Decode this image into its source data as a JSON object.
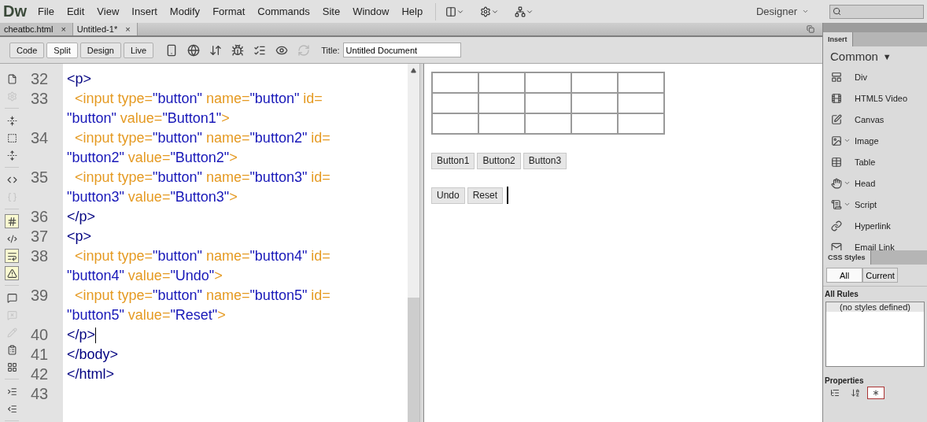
{
  "app": {
    "logo": "Dw",
    "menus": [
      "File",
      "Edit",
      "View",
      "Insert",
      "Modify",
      "Format",
      "Commands",
      "Site",
      "Window",
      "Help"
    ],
    "workspace": "Designer"
  },
  "document_tabs": [
    {
      "label": "cheatbc.html",
      "close": "×",
      "selected": false
    },
    {
      "label": "Untitled-1*",
      "close": "×",
      "selected": true
    }
  ],
  "view_buttons": [
    {
      "label": "Code",
      "selected": false
    },
    {
      "label": "Split",
      "selected": true
    },
    {
      "label": "Design",
      "selected": false
    },
    {
      "label": "Live",
      "selected": false
    }
  ],
  "toolbar_tools": [
    {
      "kind": "devices",
      "disabled": false
    },
    {
      "kind": "globe",
      "disabled": false
    },
    {
      "kind": "transfer",
      "disabled": false
    },
    {
      "kind": "debug",
      "disabled": false
    },
    {
      "kind": "check",
      "disabled": false
    },
    {
      "kind": "preview",
      "disabled": false
    },
    {
      "kind": "refresh",
      "disabled": true
    }
  ],
  "title_field": {
    "label": "Title:",
    "value": "Untitled Document"
  },
  "coding_tool_groups": [
    [
      {
        "kind": "file",
        "disabled": false,
        "selected": false
      },
      {
        "kind": "gear",
        "disabled": true,
        "selected": false
      }
    ],
    [
      {
        "kind": "collapse",
        "disabled": false,
        "selected": false
      },
      {
        "kind": "collapse-selection",
        "disabled": false,
        "selected": false
      },
      {
        "kind": "expand",
        "disabled": false,
        "selected": false
      }
    ],
    [
      {
        "kind": "select-parent",
        "disabled": false,
        "selected": false
      },
      {
        "kind": "braces",
        "disabled": true,
        "selected": false
      }
    ],
    [
      {
        "kind": "line-numbers",
        "disabled": false,
        "selected": true
      },
      {
        "kind": "highlight",
        "disabled": false,
        "selected": false
      },
      {
        "kind": "wrap",
        "disabled": false,
        "selected": true
      },
      {
        "kind": "warning",
        "disabled": false,
        "selected": true
      }
    ],
    [
      {
        "kind": "comment",
        "disabled": false,
        "selected": false
      },
      {
        "kind": "uncomment",
        "disabled": true,
        "selected": false
      },
      {
        "kind": "pencil",
        "disabled": true,
        "selected": false
      },
      {
        "kind": "snippet",
        "disabled": false,
        "selected": false
      },
      {
        "kind": "grid",
        "disabled": false,
        "selected": false
      }
    ],
    [
      {
        "kind": "indent",
        "disabled": false,
        "selected": false
      },
      {
        "kind": "outdent",
        "disabled": false,
        "selected": false
      }
    ]
  ],
  "code_lines": [
    {
      "number": "32",
      "cursor": false,
      "visual_rows": [
        {
          "tokens": [
            {
              "kind": "tag",
              "text": "<p>"
            }
          ]
        }
      ]
    },
    {
      "number": "33",
      "cursor": false,
      "visual_rows": [
        {
          "tokens": [
            {
              "kind": "element",
              "text": "  <input type="
            },
            {
              "kind": "value",
              "text": "\"button\""
            },
            {
              "kind": "attribute",
              "text": " name="
            },
            {
              "kind": "value",
              "text": "\"button\""
            },
            {
              "kind": "attribute",
              "text": " id="
            }
          ]
        },
        {
          "tokens": [
            {
              "kind": "value",
              "text": "\"button\""
            },
            {
              "kind": "attribute",
              "text": " value="
            },
            {
              "kind": "value",
              "text": "\"Button1\""
            },
            {
              "kind": "element",
              "text": ">"
            }
          ]
        }
      ]
    },
    {
      "number": "34",
      "cursor": false,
      "visual_rows": [
        {
          "tokens": [
            {
              "kind": "element",
              "text": "  <input type="
            },
            {
              "kind": "value",
              "text": "\"button\""
            },
            {
              "kind": "attribute",
              "text": " name="
            },
            {
              "kind": "value",
              "text": "\"button2\""
            },
            {
              "kind": "attribute",
              "text": " id="
            }
          ]
        },
        {
          "tokens": [
            {
              "kind": "value",
              "text": "\"button2\""
            },
            {
              "kind": "attribute",
              "text": " value="
            },
            {
              "kind": "value",
              "text": "\"Button2\""
            },
            {
              "kind": "element",
              "text": ">"
            }
          ]
        }
      ]
    },
    {
      "number": "35",
      "cursor": false,
      "visual_rows": [
        {
          "tokens": [
            {
              "kind": "element",
              "text": "  <input type="
            },
            {
              "kind": "value",
              "text": "\"button\""
            },
            {
              "kind": "attribute",
              "text": " name="
            },
            {
              "kind": "value",
              "text": "\"button3\""
            },
            {
              "kind": "attribute",
              "text": " id="
            }
          ]
        },
        {
          "tokens": [
            {
              "kind": "value",
              "text": "\"button3\""
            },
            {
              "kind": "attribute",
              "text": " value="
            },
            {
              "kind": "value",
              "text": "\"Button3\""
            },
            {
              "kind": "element",
              "text": ">"
            }
          ]
        }
      ]
    },
    {
      "number": "36",
      "cursor": false,
      "visual_rows": [
        {
          "tokens": [
            {
              "kind": "tag",
              "text": "</p>"
            }
          ]
        }
      ]
    },
    {
      "number": "37",
      "cursor": false,
      "visual_rows": [
        {
          "tokens": [
            {
              "kind": "tag",
              "text": "<p>"
            }
          ]
        }
      ]
    },
    {
      "number": "38",
      "cursor": false,
      "visual_rows": [
        {
          "tokens": [
            {
              "kind": "element",
              "text": "  <input type="
            },
            {
              "kind": "value",
              "text": "\"button\""
            },
            {
              "kind": "attribute",
              "text": " name="
            },
            {
              "kind": "value",
              "text": "\"button4\""
            },
            {
              "kind": "attribute",
              "text": " id="
            }
          ]
        },
        {
          "tokens": [
            {
              "kind": "value",
              "text": "\"button4\""
            },
            {
              "kind": "attribute",
              "text": " value="
            },
            {
              "kind": "value",
              "text": "\"Undo\""
            },
            {
              "kind": "element",
              "text": ">"
            }
          ]
        }
      ]
    },
    {
      "number": "39",
      "cursor": false,
      "visual_rows": [
        {
          "tokens": [
            {
              "kind": "element",
              "text": "  <input type="
            },
            {
              "kind": "value",
              "text": "\"button\""
            },
            {
              "kind": "attribute",
              "text": " name="
            },
            {
              "kind": "value",
              "text": "\"button5\""
            },
            {
              "kind": "attribute",
              "text": " id="
            }
          ]
        },
        {
          "tokens": [
            {
              "kind": "value",
              "text": "\"button5\""
            },
            {
              "kind": "attribute",
              "text": " value="
            },
            {
              "kind": "value",
              "text": "\"Reset\""
            },
            {
              "kind": "element",
              "text": ">"
            }
          ]
        }
      ]
    },
    {
      "number": "40",
      "cursor": true,
      "visual_rows": [
        {
          "tokens": [
            {
              "kind": "tag",
              "text": "</p>"
            }
          ]
        }
      ]
    },
    {
      "number": "41",
      "cursor": false,
      "visual_rows": [
        {
          "tokens": [
            {
              "kind": "tag",
              "text": "</body>"
            }
          ]
        }
      ]
    },
    {
      "number": "42",
      "cursor": false,
      "visual_rows": [
        {
          "tokens": [
            {
              "kind": "tag",
              "text": "</html>"
            }
          ]
        }
      ]
    },
    {
      "number": "43",
      "cursor": false,
      "visual_rows": [
        {
          "tokens": []
        }
      ]
    }
  ],
  "design_view": {
    "button_rows": [
      {
        "buttons": [
          "Button1",
          "Button2",
          "Button3"
        ],
        "caret": false
      },
      {
        "buttons": [
          "Undo",
          "Reset"
        ],
        "caret": true
      }
    ]
  },
  "insert_panel": {
    "tab": "Insert",
    "category": "Common",
    "caret": "▼",
    "items": [
      {
        "kind": "div",
        "label": "Div",
        "has_menu": false
      },
      {
        "kind": "video",
        "label": "HTML5 Video",
        "has_menu": false
      },
      {
        "kind": "canvas",
        "label": "Canvas",
        "has_menu": false
      },
      {
        "kind": "image",
        "label": "Image",
        "has_menu": true
      },
      {
        "kind": "table",
        "label": "Table",
        "has_menu": false
      },
      {
        "kind": "head",
        "label": "Head",
        "has_menu": true
      },
      {
        "kind": "script",
        "label": "Script",
        "has_menu": true
      },
      {
        "kind": "hyperlink",
        "label": "Hyperlink",
        "has_menu": false
      },
      {
        "kind": "email",
        "label": "Email Link",
        "has_menu": false
      }
    ]
  },
  "css_panel": {
    "tab": "CSS Styles",
    "modes": [
      {
        "label": "All",
        "selected": true
      },
      {
        "label": "Current",
        "selected": false
      }
    ],
    "section": "All Rules",
    "empty_text": "(no styles defined)"
  },
  "properties_panel": {
    "title": "Properties",
    "sort_tools": [
      {
        "kind": "category",
        "selected": false
      },
      {
        "kind": "alpha",
        "selected": false
      },
      {
        "kind": "set",
        "selected": true
      }
    ]
  }
}
